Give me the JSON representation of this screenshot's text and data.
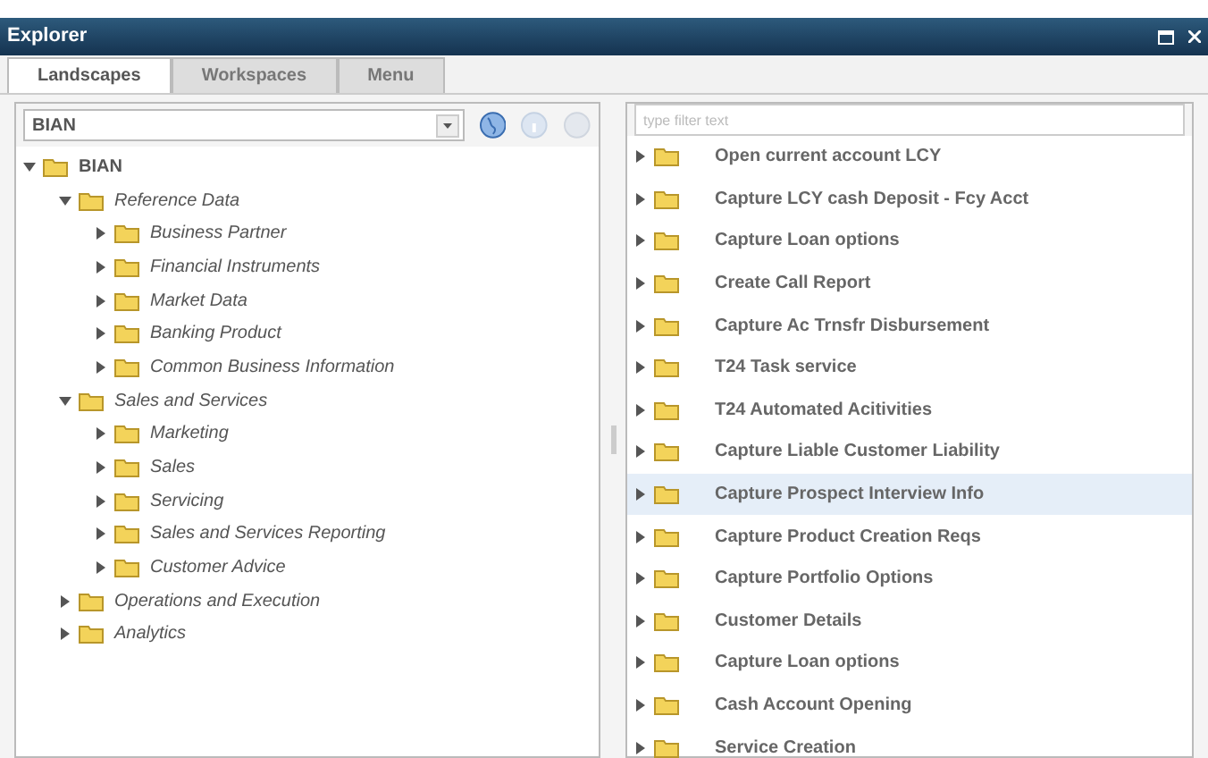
{
  "window": {
    "title": "Explorer"
  },
  "tabs": [
    {
      "label": "Landscapes",
      "selected": true
    },
    {
      "label": "Workspaces",
      "selected": false
    },
    {
      "label": "Menu",
      "selected": false
    }
  ],
  "landscape_select": {
    "value": "BIAN"
  },
  "tree": [
    {
      "label": "BIAN",
      "expanded": true,
      "italic": false,
      "children": [
        {
          "label": "Reference Data",
          "expanded": true,
          "italic": true,
          "children": [
            {
              "label": "Business Partner",
              "expanded": false,
              "italic": true
            },
            {
              "label": "Financial Instruments",
              "expanded": false,
              "italic": true
            },
            {
              "label": "Market Data",
              "expanded": false,
              "italic": true
            },
            {
              "label": "Banking Product",
              "expanded": false,
              "italic": true
            },
            {
              "label": "Common Business Information",
              "expanded": false,
              "italic": true
            }
          ]
        },
        {
          "label": "Sales and Services",
          "expanded": true,
          "italic": true,
          "children": [
            {
              "label": "Marketing",
              "expanded": false,
              "italic": true
            },
            {
              "label": "Sales",
              "expanded": false,
              "italic": true
            },
            {
              "label": "Servicing",
              "expanded": false,
              "italic": true
            },
            {
              "label": "Sales and Services Reporting",
              "expanded": false,
              "italic": true
            },
            {
              "label": "Customer Advice",
              "expanded": false,
              "italic": true
            }
          ]
        },
        {
          "label": "Operations and Execution",
          "expanded": false,
          "italic": true
        },
        {
          "label": "Analytics",
          "expanded": false,
          "italic": true
        }
      ]
    }
  ],
  "filter": {
    "placeholder": "type filter text"
  },
  "list": [
    {
      "label": "Open current account LCY",
      "selected": false
    },
    {
      "label": "Capture LCY cash Deposit - Fcy Acct",
      "selected": false
    },
    {
      "label": "Capture Loan options",
      "selected": false
    },
    {
      "label": "Create Call Report",
      "selected": false
    },
    {
      "label": "Capture Ac Trnsfr Disbursement",
      "selected": false
    },
    {
      "label": "T24 Task service",
      "selected": false
    },
    {
      "label": "T24 Automated Acitivities",
      "selected": false
    },
    {
      "label": "Capture Liable Customer Liability",
      "selected": false
    },
    {
      "label": "Capture Prospect Interview Info",
      "selected": true
    },
    {
      "label": "Capture Product Creation Reqs",
      "selected": false
    },
    {
      "label": "Capture Portfolio Options",
      "selected": false
    },
    {
      "label": "Customer Details",
      "selected": false
    },
    {
      "label": "Capture Loan options",
      "selected": false
    },
    {
      "label": "Cash Account Opening",
      "selected": false
    },
    {
      "label": "Service Creation",
      "selected": false
    }
  ]
}
